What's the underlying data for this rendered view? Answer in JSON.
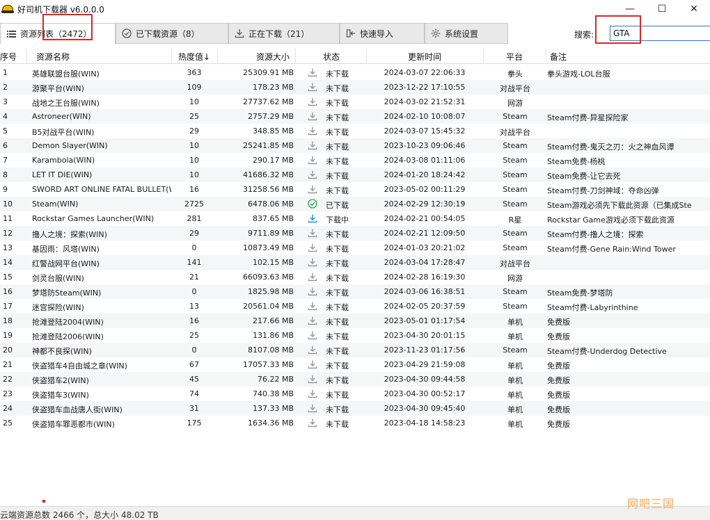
{
  "window": {
    "title": "好司机下载器 v6.0.0.0",
    "controls": {
      "minimize": "—",
      "maximize": "☐",
      "close": "✕"
    }
  },
  "tabs": [
    {
      "label": "资源列表（2472）",
      "icon": "list-icon",
      "active": true
    },
    {
      "label": "已下载资源（8）",
      "icon": "check-circle-icon",
      "active": false
    },
    {
      "label": "正在下载（21）",
      "icon": "download-icon",
      "active": false
    },
    {
      "label": "快速导入",
      "icon": "import-icon",
      "active": false
    },
    {
      "label": "系统设置",
      "icon": "gear-icon",
      "active": false
    }
  ],
  "search": {
    "label": "搜索:",
    "value": "GTA"
  },
  "columns": {
    "idx": "序号",
    "name": "资源名称",
    "heat": "热度值↓",
    "size": "资源大小",
    "status": "状态",
    "time": "更新时间",
    "platform": "平台",
    "note": "备注"
  },
  "rows": [
    {
      "idx": "1",
      "name": "英雄联盟台服(WIN)",
      "heat": "363",
      "size": "25309.91 MB",
      "status": "未下载",
      "state": "none",
      "time": "2024-03-07  22:06:33",
      "platform": "拳头",
      "note": "拳头游戏-LOL台服"
    },
    {
      "idx": "2",
      "name": "游聚平台(WIN)",
      "heat": "109",
      "size": "178.23 MB",
      "status": "未下载",
      "state": "none",
      "time": "2023-12-22  17:10:55",
      "platform": "对战平台",
      "note": ""
    },
    {
      "idx": "3",
      "name": "战地之王台服(WIN)",
      "heat": "10",
      "size": "27737.62 MB",
      "status": "未下载",
      "state": "none",
      "time": "2024-03-02  21:52:31",
      "platform": "网游",
      "note": ""
    },
    {
      "idx": "4",
      "name": "Astroneer(WIN)",
      "heat": "25",
      "size": "2757.29 MB",
      "status": "未下载",
      "state": "none",
      "time": "2024-02-10  10:08:07",
      "platform": "Steam",
      "note": "Steam付费-异星探险家"
    },
    {
      "idx": "5",
      "name": "B5对战平台(WIN)",
      "heat": "29",
      "size": "348.85 MB",
      "status": "未下载",
      "state": "none",
      "time": "2024-03-07  15:45:32",
      "platform": "对战平台",
      "note": ""
    },
    {
      "idx": "6",
      "name": "Demon Slayer(WIN)",
      "heat": "10",
      "size": "25241.85 MB",
      "status": "未下载",
      "state": "none",
      "time": "2023-10-23  09:06:46",
      "platform": "Steam",
      "note": "Steam付费-鬼灭之刃：火之神血风谭"
    },
    {
      "idx": "7",
      "name": "Karambola(WIN)",
      "heat": "10",
      "size": "290.17 MB",
      "status": "未下载",
      "state": "none",
      "time": "2024-03-08  01:11:06",
      "platform": "Steam",
      "note": "Steam免费-杨桃"
    },
    {
      "idx": "8",
      "name": "LET IT DIE(WIN)",
      "heat": "10",
      "size": "41686.32 MB",
      "status": "未下载",
      "state": "none",
      "time": "2024-01-20  18:24:42",
      "platform": "Steam",
      "note": "Steam免费-让它去死"
    },
    {
      "idx": "9",
      "name": "SWORD ART ONLINE FATAL BULLET(WIN)",
      "heat": "16",
      "size": "31258.56 MB",
      "status": "未下载",
      "state": "none",
      "time": "2023-05-02  00:11:29",
      "platform": "Steam",
      "note": "Steam付费-刀剑神域：夺命凶弹"
    },
    {
      "idx": "10",
      "name": "Steam(WIN)",
      "heat": "2725",
      "size": "6478.06 MB",
      "status": "已下载",
      "state": "done",
      "time": "2024-02-29  12:30:19",
      "platform": "Steam",
      "note": "Steam游戏必须先下载此资源（已集成Ste"
    },
    {
      "idx": "11",
      "name": "Rockstar Games Launcher(WIN)",
      "heat": "281",
      "size": "837.65 MB",
      "status": "下载中",
      "state": "downloading",
      "time": "2024-02-21  00:54:05",
      "platform": "R星",
      "note": "Rockstar Game游戏必须下载此资源"
    },
    {
      "idx": "12",
      "name": "撸人之境：探索(WIN)",
      "heat": "29",
      "size": "9711.89 MB",
      "status": "未下载",
      "state": "none",
      "time": "2024-02-21  12:09:50",
      "platform": "Steam",
      "note": "Steam付费-撸人之境：探索"
    },
    {
      "idx": "13",
      "name": "基因雨：风塔(WIN)",
      "heat": "0",
      "size": "10873.49 MB",
      "status": "未下载",
      "state": "none",
      "time": "2024-01-03  20:21:02",
      "platform": "Steam",
      "note": "Steam付费-Gene Rain:Wind Tower"
    },
    {
      "idx": "14",
      "name": "红警战网平台(WIN)",
      "heat": "141",
      "size": "102.15 MB",
      "status": "未下载",
      "state": "none",
      "time": "2024-03-04  17:28:47",
      "platform": "对战平台",
      "note": ""
    },
    {
      "idx": "15",
      "name": "剑灵台服(WIN)",
      "heat": "21",
      "size": "66093.63 MB",
      "status": "未下载",
      "state": "none",
      "time": "2024-02-28  16:19:30",
      "platform": "网游",
      "note": ""
    },
    {
      "idx": "16",
      "name": "梦塔防Steam(WIN)",
      "heat": "0",
      "size": "1825.98 MB",
      "status": "未下载",
      "state": "none",
      "time": "2024-03-06  16:38:51",
      "platform": "Steam",
      "note": "Steam免费-梦塔防"
    },
    {
      "idx": "17",
      "name": "迷宫探险(WIN)",
      "heat": "13",
      "size": "20561.04 MB",
      "status": "未下载",
      "state": "none",
      "time": "2024-02-05  20:37:59",
      "platform": "Steam",
      "note": "Steam付费-Labyrinthine"
    },
    {
      "idx": "18",
      "name": "抢滩登陆2004(WIN)",
      "heat": "16",
      "size": "217.66 MB",
      "status": "未下载",
      "state": "none",
      "time": "2023-05-01  01:17:54",
      "platform": "单机",
      "note": "免费版"
    },
    {
      "idx": "19",
      "name": "抢滩登陆2006(WIN)",
      "heat": "25",
      "size": "131.86 MB",
      "status": "未下载",
      "state": "none",
      "time": "2023-04-30  20:01:15",
      "platform": "单机",
      "note": "免费版"
    },
    {
      "idx": "20",
      "name": "神都不良探(WIN)",
      "heat": "0",
      "size": "8107.08 MB",
      "status": "未下载",
      "state": "none",
      "time": "2023-11-23  01:17:56",
      "platform": "Steam",
      "note": "Steam付费-Underdog Detective"
    },
    {
      "idx": "21",
      "name": "侠盗猎车4自由城之章(WIN)",
      "heat": "67",
      "size": "17057.33 MB",
      "status": "未下载",
      "state": "none",
      "time": "2023-04-29  21:59:08",
      "platform": "单机",
      "note": "免费版"
    },
    {
      "idx": "22",
      "name": "侠盗猎车2(WIN)",
      "heat": "45",
      "size": "76.22 MB",
      "status": "未下载",
      "state": "none",
      "time": "2023-04-30  09:44:58",
      "platform": "单机",
      "note": "免费版"
    },
    {
      "idx": "23",
      "name": "侠盗猎车3(WIN)",
      "heat": "74",
      "size": "740.38 MB",
      "status": "未下载",
      "state": "none",
      "time": "2023-04-30  00:52:17",
      "platform": "单机",
      "note": "免费版"
    },
    {
      "idx": "24",
      "name": "侠盗猎车血战唐人街(WIN)",
      "heat": "31",
      "size": "137.33 MB",
      "status": "未下载",
      "state": "none",
      "time": "2023-04-30  09:45:40",
      "platform": "单机",
      "note": "免费版"
    },
    {
      "idx": "25",
      "name": "侠盗猎车罪恶都市(WIN)",
      "heat": "175",
      "size": "1634.36 MB",
      "status": "未下载",
      "state": "none",
      "time": "2023-04-18  14:58:23",
      "platform": "单机",
      "note": "免费版"
    }
  ],
  "statusbar": {
    "text": "云端资源总数 2466 个，总大小 48.02 TB"
  },
  "watermark": "网吧三国",
  "colors": {
    "accent": "#1e7cd6",
    "highlight": "#e02424",
    "done": "#2ca24a",
    "downloading": "#1e8fe0",
    "idle": "#8a8a8a"
  }
}
